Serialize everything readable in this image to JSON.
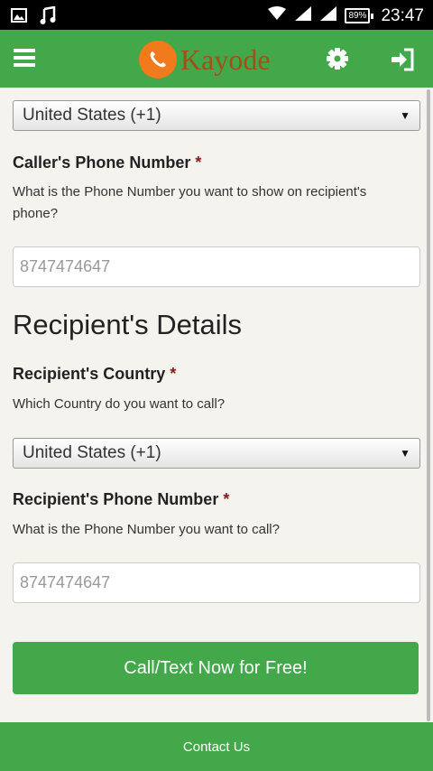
{
  "status_bar": {
    "time": "23:47",
    "battery": "89%"
  },
  "header": {
    "brand": "Kayode"
  },
  "caller": {
    "country_selected": "United States (+1)",
    "phone_label": "Caller's Phone Number",
    "required_mark": "*",
    "phone_help": "What is the Phone Number you want to show on recipient's phone?",
    "phone_placeholder": "8747474647"
  },
  "recipient": {
    "section_title": "Recipient's Details",
    "country_label": "Recipient's Country",
    "required_mark": "*",
    "country_help": "Which Country do you want to call?",
    "country_selected": "United States (+1)",
    "phone_label": "Recipient's Phone Number",
    "phone_help": "What is the Phone Number you want to call?",
    "phone_placeholder": "8747474647"
  },
  "submit_label": "Call/Text Now for Free!",
  "footer": {
    "contact_label": "Contact Us"
  }
}
